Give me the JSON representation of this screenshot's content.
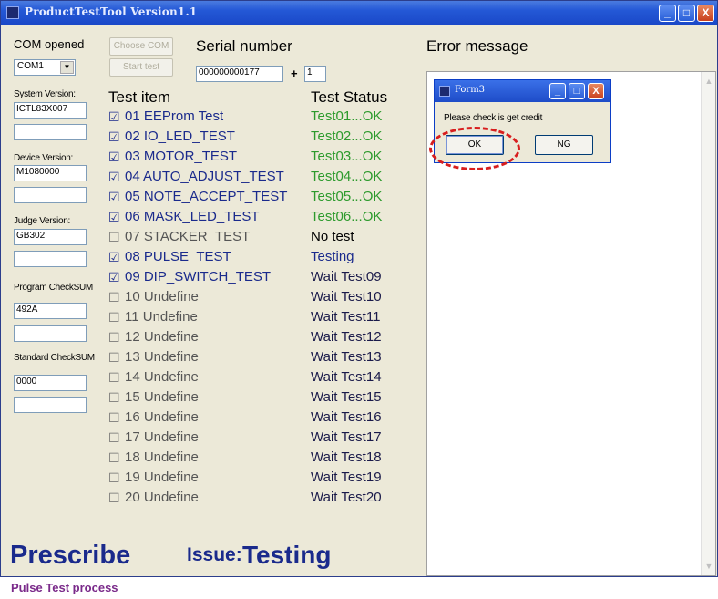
{
  "window": {
    "title": "ProductTestTool  Version1.1"
  },
  "titlebar_buttons": {
    "minimize": "_",
    "maximize": "□",
    "close": "X"
  },
  "left_panel": {
    "com_opened_label": "COM opened",
    "com_select_value": "COM1",
    "choose_com_button": "Choose COM",
    "start_test_button": "Start test",
    "system_version_label": "System Version:",
    "system_version_value": "ICTL83X007",
    "system_version_value2": "",
    "device_version_label": "Device Version:",
    "device_version_value": "M1080000",
    "device_version_value2": "",
    "judge_version_label": "Judge  Version:",
    "judge_version_value": "GB302",
    "judge_version_value2": "",
    "program_checksum_label": "Program CheckSUM",
    "program_checksum_value": "492A",
    "program_checksum_value2": "",
    "standard_checksum_label": "Standard CheckSUM",
    "standard_checksum_value": "0000",
    "standard_checksum_value2": ""
  },
  "serial": {
    "label": "Serial number",
    "value": "000000000177",
    "plus": "+",
    "increment": "1"
  },
  "tests": {
    "item_header": "Test item",
    "status_header": "Test Status",
    "rows": [
      {
        "checked": true,
        "name": "01 EEProm Test",
        "status": "Test01...OK",
        "state": "ok"
      },
      {
        "checked": true,
        "name": "02 IO_LED_TEST",
        "status": "Test02...OK",
        "state": "ok"
      },
      {
        "checked": true,
        "name": "03 MOTOR_TEST",
        "status": "Test03...OK",
        "state": "ok"
      },
      {
        "checked": true,
        "name": "04 AUTO_ADJUST_TEST",
        "status": "Test04...OK",
        "state": "ok"
      },
      {
        "checked": true,
        "name": "05 NOTE_ACCEPT_TEST",
        "status": "Test05...OK",
        "state": "ok"
      },
      {
        "checked": true,
        "name": "06 MASK_LED_TEST",
        "status": "Test06...OK",
        "state": "ok"
      },
      {
        "checked": false,
        "name": "07 STACKER_TEST",
        "status": "No test",
        "state": "none"
      },
      {
        "checked": true,
        "name": "08 PULSE_TEST",
        "status": "Testing",
        "state": "testing"
      },
      {
        "checked": true,
        "name": "09 DIP_SWITCH_TEST",
        "status": "Wait Test09",
        "state": "wait"
      },
      {
        "checked": false,
        "name": "10 Undefine",
        "status": "Wait Test10",
        "state": "wait"
      },
      {
        "checked": false,
        "name": "11 Undefine",
        "status": "Wait Test11",
        "state": "wait"
      },
      {
        "checked": false,
        "name": "12 Undefine",
        "status": "Wait Test12",
        "state": "wait"
      },
      {
        "checked": false,
        "name": "13 Undefine",
        "status": "Wait Test13",
        "state": "wait"
      },
      {
        "checked": false,
        "name": "14 Undefine",
        "status": "Wait Test14",
        "state": "wait"
      },
      {
        "checked": false,
        "name": "15 Undefine",
        "status": "Wait Test15",
        "state": "wait"
      },
      {
        "checked": false,
        "name": "16 Undefine",
        "status": "Wait Test16",
        "state": "wait"
      },
      {
        "checked": false,
        "name": "17 Undefine",
        "status": "Wait Test17",
        "state": "wait"
      },
      {
        "checked": false,
        "name": "18 Undefine",
        "status": "Wait Test18",
        "state": "wait"
      },
      {
        "checked": false,
        "name": "19 Undefine",
        "status": "Wait Test19",
        "state": "wait"
      },
      {
        "checked": false,
        "name": "20 Undefine",
        "status": "Wait Test20",
        "state": "wait"
      }
    ]
  },
  "error_panel": {
    "label": "Error message"
  },
  "dialog": {
    "title": "Form3",
    "message": "Please check is get credit",
    "ok_button": "OK",
    "ng_button": "NG"
  },
  "footer": {
    "prescribe": "Prescribe",
    "issue_label": "Issue:",
    "issue_value": "Testing",
    "status_text": "Pulse Test process"
  },
  "colors": {
    "titlebar": "#2458d6",
    "ok_status": "#2c9a2c",
    "brand_blue": "#1a2a8c",
    "status_purple": "#7a2a8a",
    "highlight_red": "#d81e1e"
  }
}
